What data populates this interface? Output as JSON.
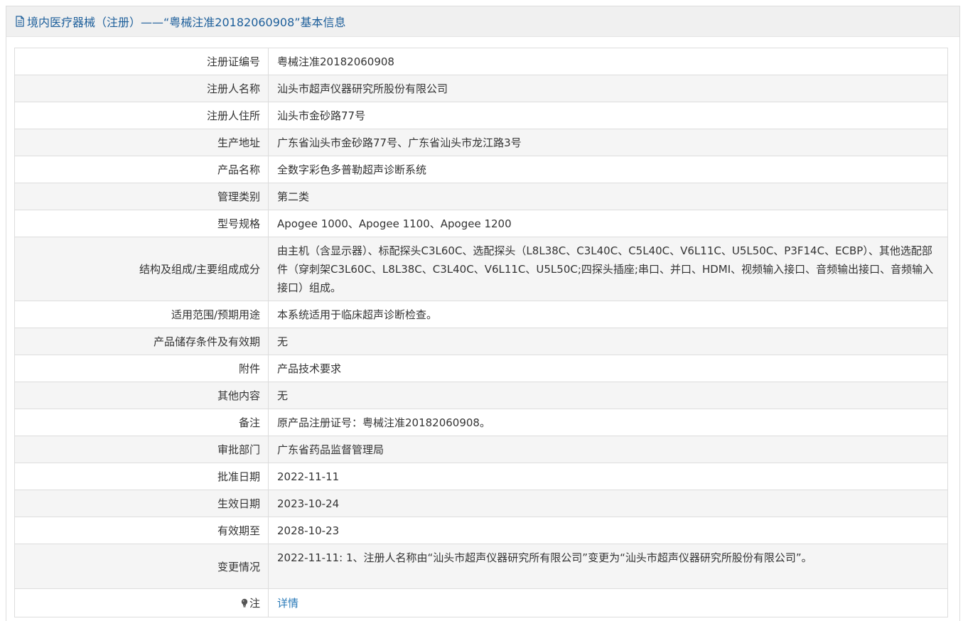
{
  "header": {
    "title": "境内医疗器械（注册）——“粤械注准20182060908”基本信息",
    "icon": "document-icon"
  },
  "rows": [
    {
      "label": "注册证编号",
      "value": "粤械注准20182060908"
    },
    {
      "label": "注册人名称",
      "value": "汕头市超声仪器研究所股份有限公司"
    },
    {
      "label": "注册人住所",
      "value": "汕头市金砂路77号"
    },
    {
      "label": "生产地址",
      "value": "广东省汕头市金砂路77号、广东省汕头市龙江路3号"
    },
    {
      "label": "产品名称",
      "value": "全数字彩色多普勒超声诊断系统"
    },
    {
      "label": "管理类别",
      "value": "第二类"
    },
    {
      "label": "型号规格",
      "value": "Apogee 1000、Apogee 1100、Apogee 1200"
    },
    {
      "label": "结构及组成/主要组成成分",
      "value": "由主机（含显示器）、标配探头C3L60C、选配探头（L8L38C、C3L40C、C5L40C、V6L11C、U5L50C、P3F14C、ECBP）、其他选配部件（穿刺架C3L60C、L8L38C、C3L40C、V6L11C、U5L50C;四探头插座;串口、并口、HDMI、视频输入接口、音频输出接口、音频输入接口）组成。"
    },
    {
      "label": "适用范围/预期用途",
      "value": "本系统适用于临床超声诊断检查。"
    },
    {
      "label": "产品储存条件及有效期",
      "value": "无"
    },
    {
      "label": "附件",
      "value": "产品技术要求"
    },
    {
      "label": "其他内容",
      "value": "无"
    },
    {
      "label": "备注",
      "value": "原产品注册证号：粤械注准20182060908。"
    },
    {
      "label": "审批部门",
      "value": "广东省药品监督管理局"
    },
    {
      "label": "批准日期",
      "value": "2022-11-11"
    },
    {
      "label": "生效日期",
      "value": "2023-10-24"
    },
    {
      "label": "有效期至",
      "value": "2028-10-23"
    },
    {
      "label": "变更情况",
      "value": "2022-11-11: 1、注册人名称由“汕头市超声仪器研究所有限公司”变更为“汕头市超声仪器研究所股份有限公司”。"
    },
    {
      "label": "注",
      "value": "详情",
      "icon": "lightbulb-icon"
    }
  ],
  "colors": {
    "title": "#1c5e9a",
    "link": "#2a7ab8",
    "header_bg": "#f0f0f0",
    "alt_row_bg": "#f5f5f5",
    "border": "#dddddd"
  }
}
